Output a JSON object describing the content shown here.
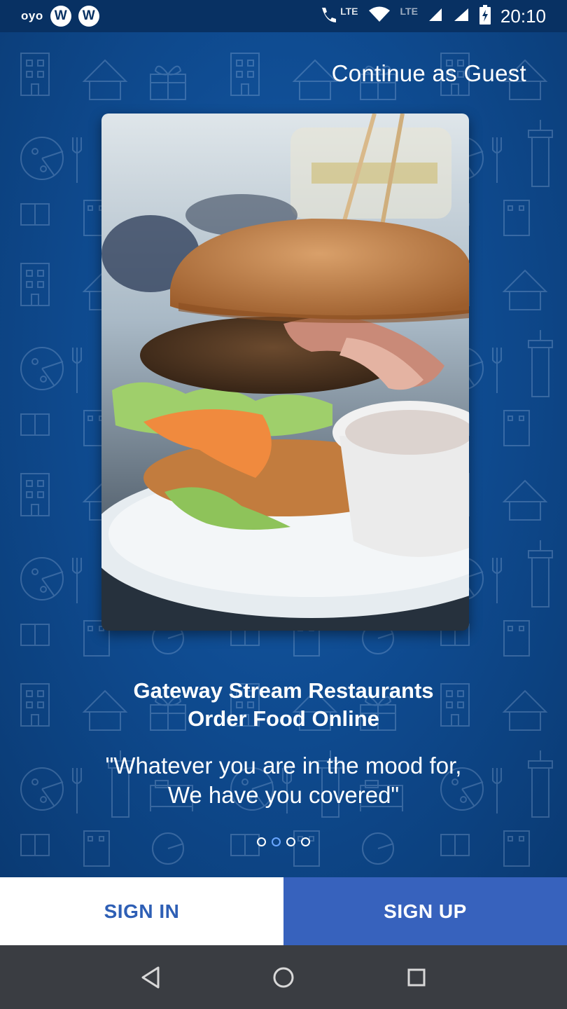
{
  "status_bar": {
    "carrier_logo": "oyo",
    "app_icons": [
      "W",
      "W"
    ],
    "lte_1": "LTE",
    "lte_2": "LTE",
    "time": "20:10",
    "icons": [
      "wifi-calling-icon",
      "wifi-icon",
      "signal-icon",
      "signal-icon",
      "battery-charging-icon"
    ]
  },
  "header": {
    "guest_link": "Continue as Guest"
  },
  "hero": {
    "image_subject": "burger-photo"
  },
  "title": {
    "line1": "Gateway Stream Restaurants",
    "line2": "Order Food Online"
  },
  "quote": {
    "line1": "\"Whatever you are in the mood for,",
    "line2": "We have you covered\""
  },
  "pager": {
    "count": 4,
    "active_index": 1
  },
  "buttons": {
    "sign_in": "SIGN IN",
    "sign_up": "SIGN UP"
  },
  "colors": {
    "background": "#0f4c92",
    "sign_up_bg": "#3762bd",
    "sign_in_text": "#2e5fb5",
    "nav_bar": "#3a3d42"
  },
  "nav_bar": {
    "icons": [
      "back-icon",
      "home-icon",
      "recents-icon"
    ]
  }
}
